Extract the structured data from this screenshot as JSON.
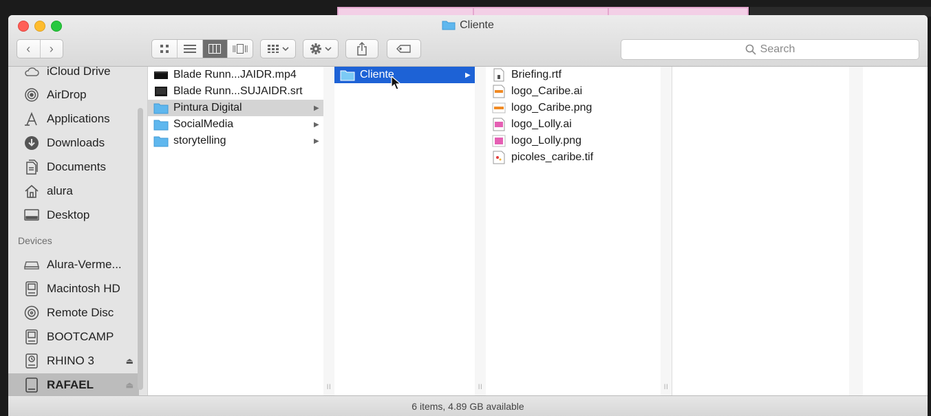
{
  "window": {
    "title": "Cliente"
  },
  "toolbar": {
    "back_glyph": "‹",
    "forward_glyph": "›",
    "search_placeholder": "Search"
  },
  "sidebar": {
    "items_top": [
      {
        "label": "iCloud Drive",
        "icon": "cloud-icon"
      },
      {
        "label": "AirDrop",
        "icon": "airdrop-icon"
      },
      {
        "label": "Applications",
        "icon": "applications-icon"
      },
      {
        "label": "Downloads",
        "icon": "downloads-icon"
      },
      {
        "label": "Documents",
        "icon": "documents-icon"
      },
      {
        "label": "alura",
        "icon": "home-icon"
      },
      {
        "label": "Desktop",
        "icon": "desktop-icon"
      }
    ],
    "devices_header": "Devices",
    "devices": [
      {
        "label": "Alura-Verme...",
        "icon": "network-drive-icon"
      },
      {
        "label": "Macintosh HD",
        "icon": "hard-disk-icon"
      },
      {
        "label": "Remote Disc",
        "icon": "remote-disc-icon"
      },
      {
        "label": "BOOTCAMP",
        "icon": "hard-disk-icon"
      },
      {
        "label": "RHINO 3",
        "icon": "time-machine-disk-icon",
        "eject": "⏏"
      },
      {
        "label": "RAFAEL",
        "icon": "external-drive-icon",
        "eject": "⏏"
      }
    ]
  },
  "columns": {
    "col1": [
      {
        "label": "Blade Runn...JAIDR.mp4",
        "icon": "video-file-icon"
      },
      {
        "label": "Blade Runn...SUJAIDR.srt",
        "icon": "subtitle-file-icon"
      },
      {
        "label": "Pintura Digital",
        "icon": "folder-icon",
        "arrow": "▶"
      },
      {
        "label": "SocialMedia",
        "icon": "folder-icon",
        "arrow": "▶"
      },
      {
        "label": "storytelling",
        "icon": "folder-icon",
        "arrow": "▶"
      }
    ],
    "col2": [
      {
        "label": "Cliente",
        "icon": "folder-icon",
        "arrow": "▶"
      }
    ],
    "col3": [
      {
        "label": "Briefing.rtf",
        "icon": "rtf-file-icon"
      },
      {
        "label": "logo_Caribe.ai",
        "icon": "ai-file-icon"
      },
      {
        "label": "logo_Caribe.png",
        "icon": "png-file-icon"
      },
      {
        "label": "logo_Lolly.ai",
        "icon": "ai-file-icon"
      },
      {
        "label": "logo_Lolly.png",
        "icon": "png-file-icon"
      },
      {
        "label": "picoles_caribe.tif",
        "icon": "tif-file-icon"
      }
    ]
  },
  "status": {
    "text": "6 items, 4.89 GB available"
  },
  "gutter_grip": "ll",
  "colors": {
    "selection_blue": "#1d62d6",
    "folder_blue": "#5fb7ee",
    "close": "#ff5f57",
    "minimize": "#febc2e",
    "zoom": "#28c840"
  }
}
